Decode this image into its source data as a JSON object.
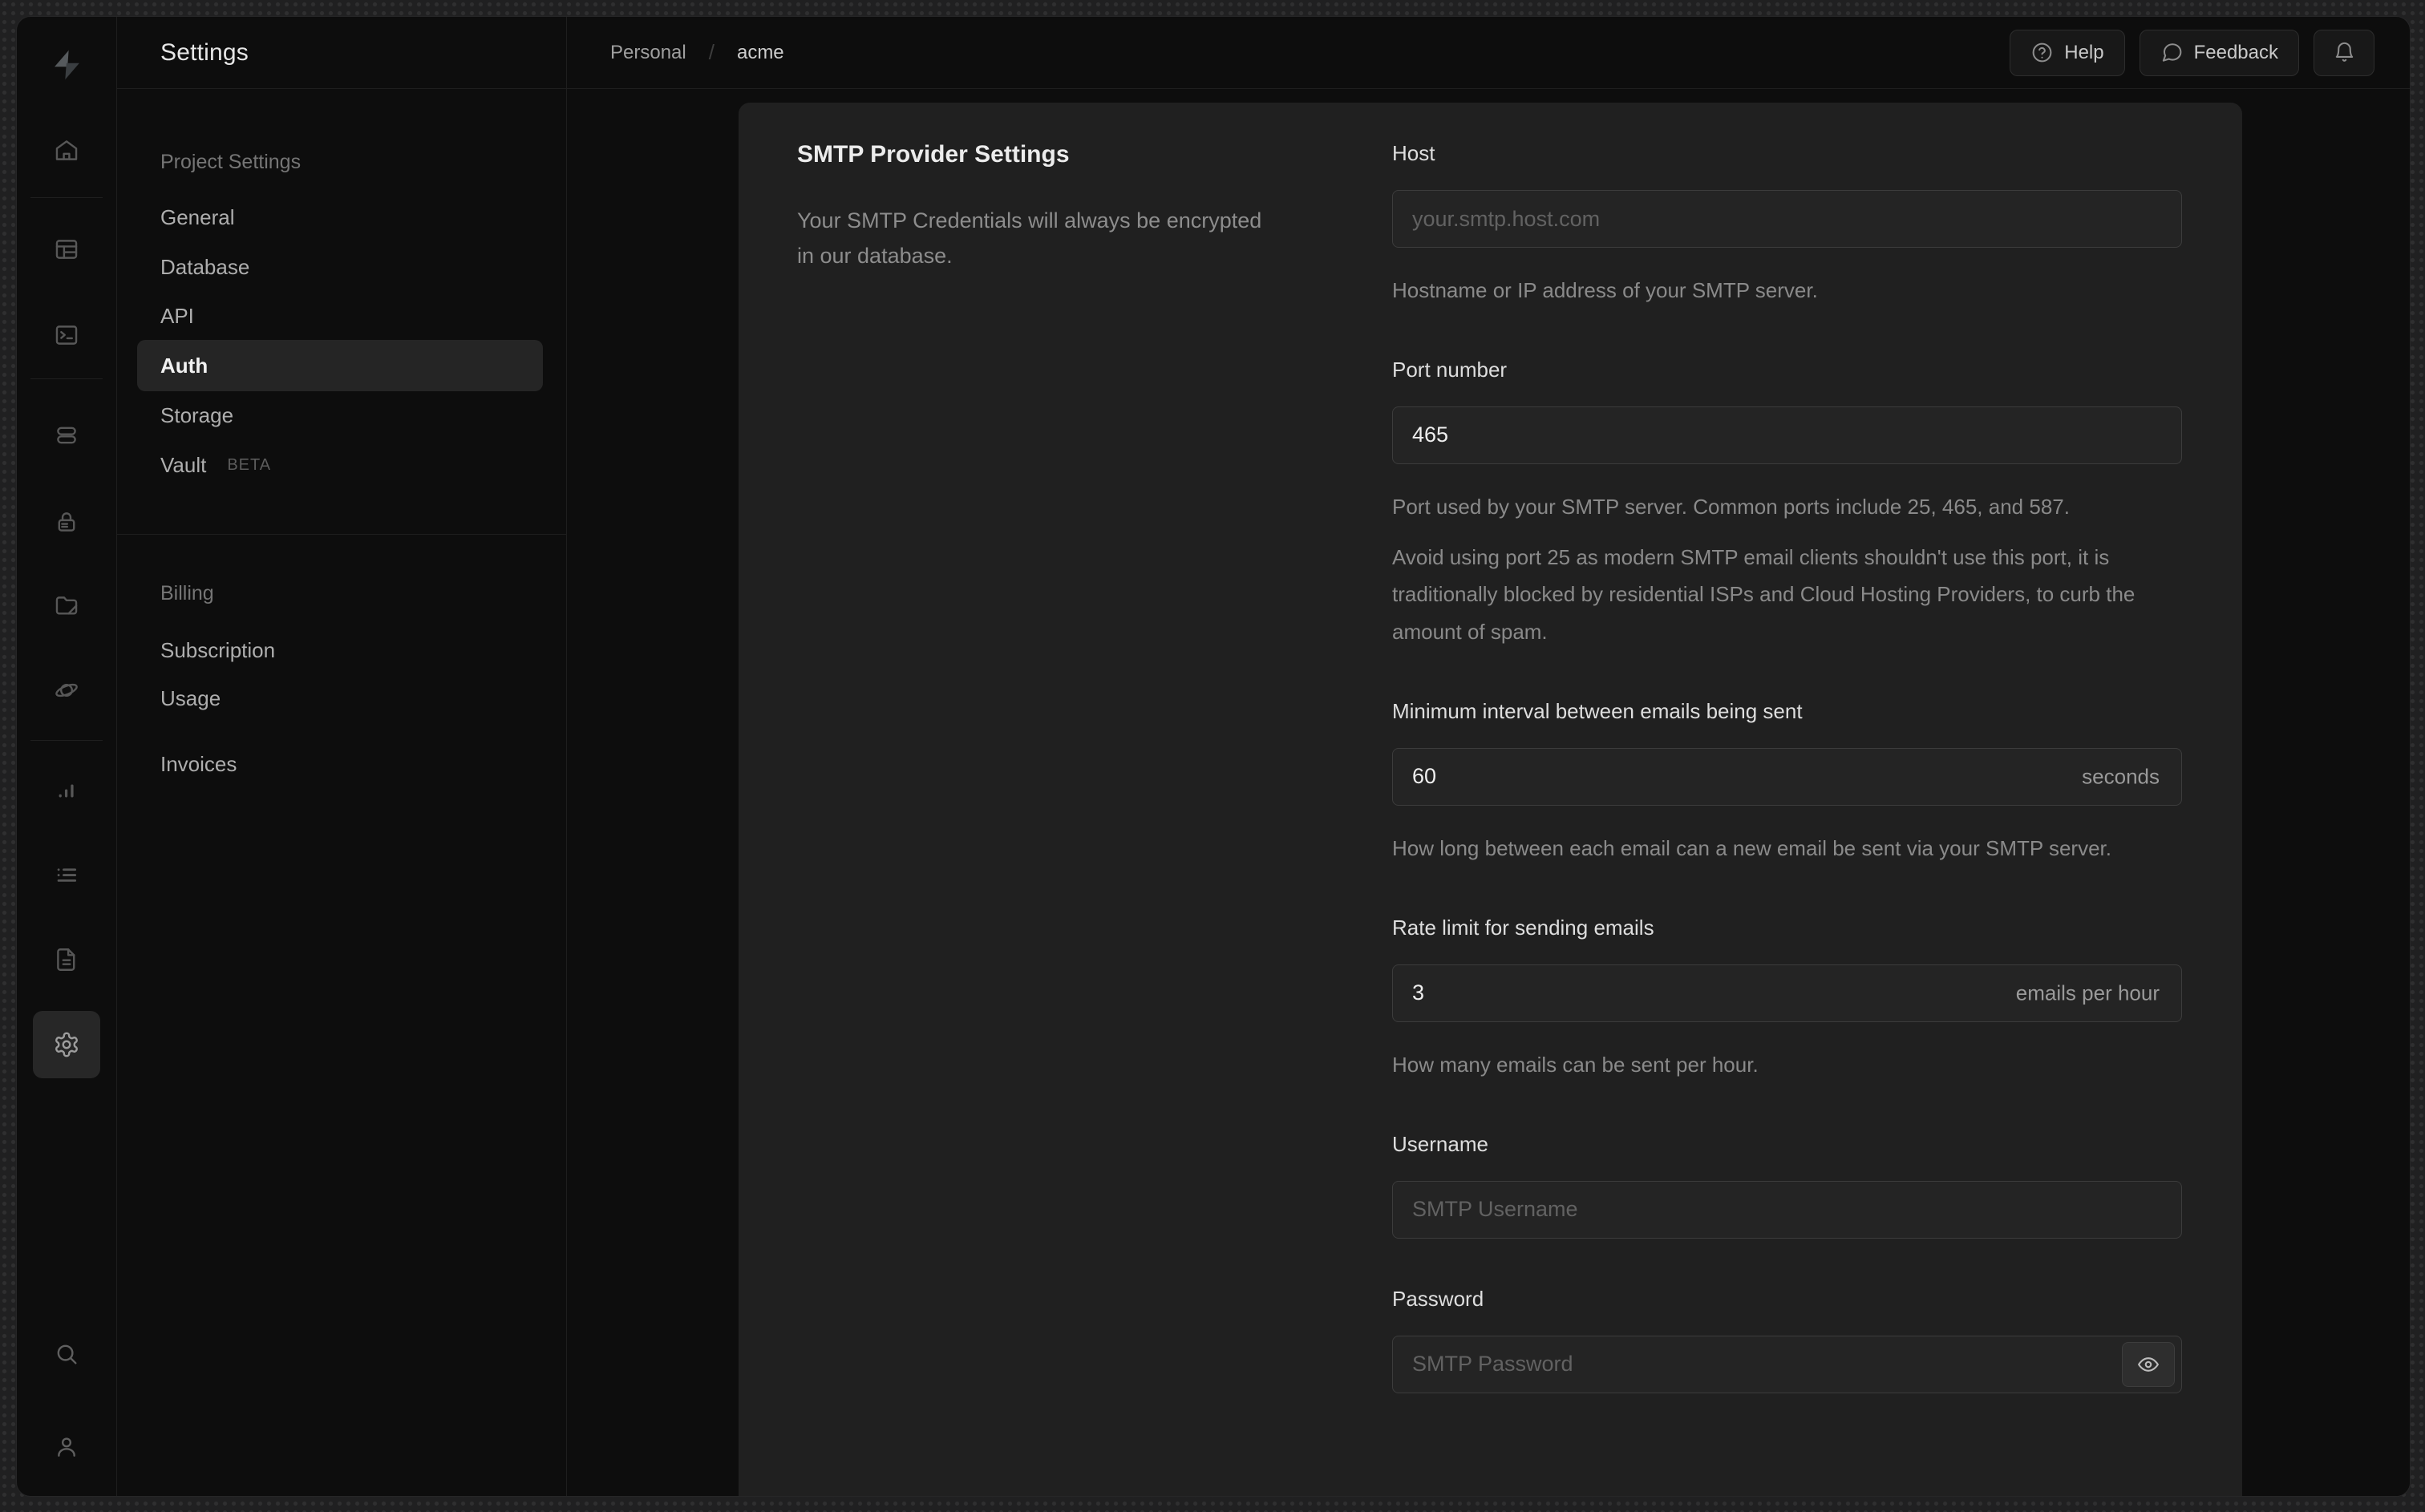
{
  "colors": {
    "desktop_bg": "#202021",
    "window_bg": "#0d0d0d",
    "card_bg": "#202020",
    "input_bg": "#242424",
    "input_border": "#3c3c3c",
    "active_nav_bg": "#252525",
    "text_primary": "#ececec",
    "text_muted": "#8a8a8a"
  },
  "rail_icons": [
    "supabase-logo",
    "home",
    "table-editor",
    "sql-editor",
    "database",
    "authentication",
    "storage",
    "edge-functions",
    "reports",
    "logs",
    "api-docs",
    "project-settings",
    "search",
    "profile"
  ],
  "nav": {
    "title": "Settings",
    "sections": [
      {
        "header": "Project Settings",
        "items": [
          {
            "label": "General"
          },
          {
            "label": "Database"
          },
          {
            "label": "API"
          },
          {
            "label": "Auth",
            "active": true
          },
          {
            "label": "Storage"
          },
          {
            "label": "Vault",
            "badge": "BETA"
          }
        ]
      },
      {
        "header": "Billing",
        "items": [
          {
            "label": "Subscription"
          },
          {
            "label": "Usage"
          },
          {
            "label": "Invoices"
          }
        ]
      }
    ]
  },
  "topbar": {
    "breadcrumb": {
      "org": "Personal",
      "separator": "/",
      "project": "acme"
    },
    "help_label": "Help",
    "feedback_label": "Feedback",
    "icons": {
      "help": "circle-question",
      "feedback": "speech-bubble",
      "notifications": "bell"
    }
  },
  "smtp": {
    "title": "SMTP Provider Settings",
    "description": "Your SMTP Credentials will always be encrypted in our database.",
    "host": {
      "label": "Host",
      "placeholder": "your.smtp.host.com",
      "helper": "Hostname or IP address of your SMTP server."
    },
    "port": {
      "label": "Port number",
      "value": "465",
      "helper": "Port used by your SMTP server. Common ports include 25, 465, and 587.",
      "warning": "Avoid using port 25 as modern SMTP email clients shouldn't use this port, it is traditionally blocked by residential ISPs and Cloud Hosting Providers, to curb the amount of spam."
    },
    "interval": {
      "label": "Minimum interval between emails being sent",
      "value": "60",
      "suffix": "seconds",
      "helper": "How long between each email can a new email be sent via your SMTP server."
    },
    "rate": {
      "label": "Rate limit for sending emails",
      "value": "3",
      "suffix": "emails per hour",
      "helper": "How many emails can be sent per hour."
    },
    "username": {
      "label": "Username",
      "placeholder": "SMTP Username"
    },
    "password": {
      "label": "Password",
      "placeholder": "SMTP Password",
      "reveal_icon": "eye"
    }
  }
}
